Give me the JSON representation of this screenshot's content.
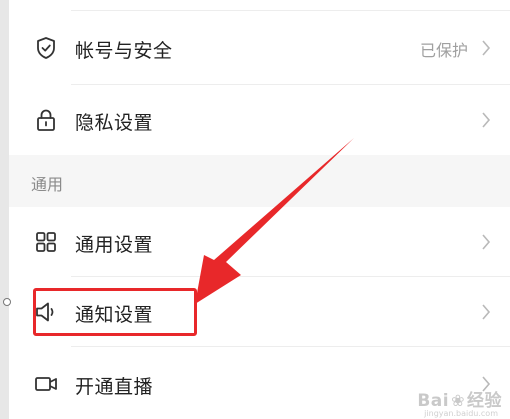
{
  "settings": {
    "items": [
      {
        "label": "帐号与安全",
        "value": "已保护",
        "icon": "shield-check-icon"
      },
      {
        "label": "隐私设置",
        "value": "",
        "icon": "lock-icon"
      }
    ],
    "section_title": "通用",
    "general_items": [
      {
        "label": "通用设置",
        "icon": "grid-icon"
      },
      {
        "label": "通知设置",
        "icon": "speaker-icon"
      },
      {
        "label": "开通直播",
        "icon": "video-camera-icon"
      }
    ]
  },
  "annotation": {
    "highlight_color": "#e8282a",
    "arrow_color": "#e8282a"
  },
  "watermark": {
    "logo_text": "Bai",
    "logo_text2": "经验",
    "url": "jingyan.baidu.com"
  }
}
